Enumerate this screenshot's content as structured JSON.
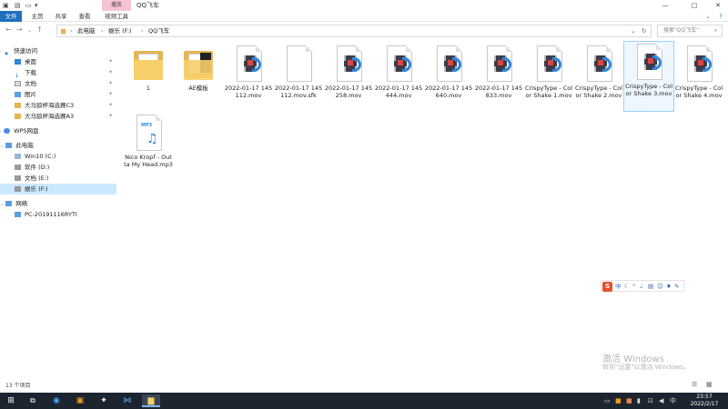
{
  "window": {
    "title": "QQ飞车",
    "context_tab": "播放",
    "quick_access_arrow": "▾"
  },
  "ribbon": {
    "tabs": [
      "文件",
      "主页",
      "共享",
      "查看",
      "视频工具"
    ]
  },
  "address": {
    "crumbs": [
      "此电脑",
      "娱乐 (F:)",
      "QQ飞车"
    ],
    "separator": "›",
    "search_placeholder": "搜索\"QQ飞车\""
  },
  "nav": {
    "quick_access": "快速访问",
    "quick_items": [
      "桌面",
      "下载",
      "文档",
      "图片",
      "大马狼杯海选赛C3",
      "大马狼杯海选赛A3"
    ],
    "wps": "WPS网盘",
    "this_pc": "此电脑",
    "drives": [
      "Win10 (C:)",
      "软件 (D:)",
      "文档 (E:)",
      "娱乐 (F:)"
    ],
    "network": "网络",
    "network_items": [
      "PC-20191116RYTI"
    ]
  },
  "files": [
    {
      "name": "1",
      "type": "folder"
    },
    {
      "name": "AE模板",
      "type": "folder-dark"
    },
    {
      "name": "2022-01-17 145112.mov",
      "type": "video"
    },
    {
      "name": "2022-01-17 145112.mov.sfk",
      "type": "blank"
    },
    {
      "name": "2022-01-17 145258.mov",
      "type": "video"
    },
    {
      "name": "2022-01-17 145444.mov",
      "type": "video"
    },
    {
      "name": "2022-01-17 145640.mov",
      "type": "video"
    },
    {
      "name": "2022-01-17 145833.mov",
      "type": "video"
    },
    {
      "name": "CrispyType - Color Shake 1.mov",
      "type": "video"
    },
    {
      "name": "CrispyType - Color Shake 2.mov",
      "type": "video"
    },
    {
      "name": "CrispyType - Color Shake 3.mov",
      "type": "video",
      "selected": true
    },
    {
      "name": "CrispyType - Color Shake 4.mov",
      "type": "video"
    },
    {
      "name": "Nico Kropf - Outta My Head.mp3",
      "type": "audio"
    }
  ],
  "status": {
    "item_count": "13 个项目"
  },
  "ime": {
    "logo": "S",
    "mode": "中"
  },
  "watermark": {
    "line1": "激活 Windows",
    "line2": "转到\"设置\"以激活 Windows。"
  },
  "taskbar": {
    "time": "23:57",
    "date": "2022/2/17",
    "lang": "中"
  }
}
